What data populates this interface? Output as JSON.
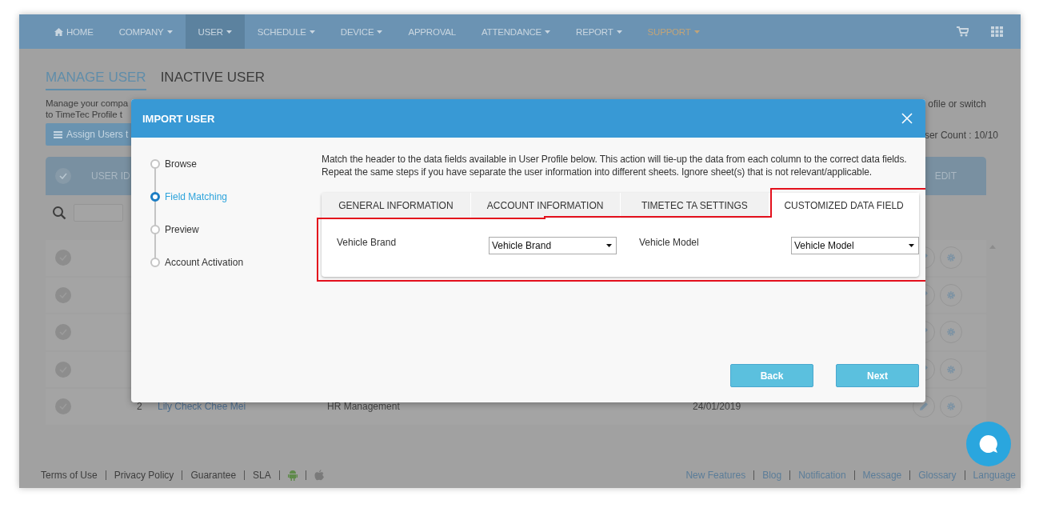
{
  "nav": {
    "items": [
      {
        "label": "HOME",
        "caret": false,
        "selected": false,
        "kind": "home"
      },
      {
        "label": "COMPANY",
        "caret": true,
        "selected": false,
        "kind": "plain"
      },
      {
        "label": "USER",
        "caret": true,
        "selected": true,
        "kind": "plain"
      },
      {
        "label": "SCHEDULE",
        "caret": true,
        "selected": false,
        "kind": "plain"
      },
      {
        "label": "DEVICE",
        "caret": true,
        "selected": false,
        "kind": "plain"
      },
      {
        "label": "APPROVAL",
        "caret": false,
        "selected": false,
        "kind": "plain"
      },
      {
        "label": "ATTENDANCE",
        "caret": true,
        "selected": false,
        "kind": "plain"
      },
      {
        "label": "REPORT",
        "caret": true,
        "selected": false,
        "kind": "plain"
      },
      {
        "label": "SUPPORT",
        "caret": true,
        "selected": false,
        "kind": "support"
      }
    ]
  },
  "page_tabs": [
    {
      "label": "MANAGE USER",
      "selected": true
    },
    {
      "label": "INACTIVE USER",
      "selected": false
    }
  ],
  "description": {
    "line_1": "Manage your compa",
    "line_2": "to TimeTec Profile t",
    "right": "ofile or switch"
  },
  "assign_button": "Assign Users t",
  "user_count": "ser Count : 10/10",
  "table": {
    "columns": [
      "USER ID",
      "EDIT"
    ],
    "select_all_checked": false,
    "rows": [
      {
        "checked": false,
        "cells": []
      },
      {
        "checked": false,
        "cells": []
      },
      {
        "checked": false,
        "cells": []
      },
      {
        "checked": false,
        "cells": []
      },
      {
        "checked": false,
        "cells": [
          "2",
          "Lily Check Chee Mei",
          "HR Management",
          "24/01/2019"
        ]
      }
    ]
  },
  "modal": {
    "title": "IMPORT USER",
    "steps": [
      {
        "label": "Browse",
        "selected": false
      },
      {
        "label": "Field Matching",
        "selected": true
      },
      {
        "label": "Preview",
        "selected": false
      },
      {
        "label": "Account Activation",
        "selected": false
      }
    ],
    "instruction": "Match the header to the data fields available in User Profile below. This action will tie-up the data from each column to the correct data fields. Repeat the same steps if you have separate the user information into different sheets. Ignore sheet(s) that is not relevant/applicable.",
    "tabs": [
      {
        "label": "GENERAL INFORMATION",
        "selected": false
      },
      {
        "label": "ACCOUNT INFORMATION",
        "selected": false
      },
      {
        "label": "TIMETEC TA SETTINGS",
        "selected": false
      },
      {
        "label": "CUSTOMIZED DATA FIELD",
        "selected": true
      }
    ],
    "fields": [
      {
        "label": "Vehicle Brand",
        "value": "Vehicle Brand"
      },
      {
        "label": "Vehicle Model",
        "value": "Vehicle Model"
      }
    ],
    "buttons": [
      "Back",
      "Next"
    ]
  },
  "footer": {
    "left": [
      "Terms of Use",
      "Privacy Policy",
      "Guarantee",
      "SLA"
    ],
    "right": [
      "New Features",
      "Blog",
      "Notification",
      "Message",
      "Glossary",
      "Language"
    ]
  }
}
